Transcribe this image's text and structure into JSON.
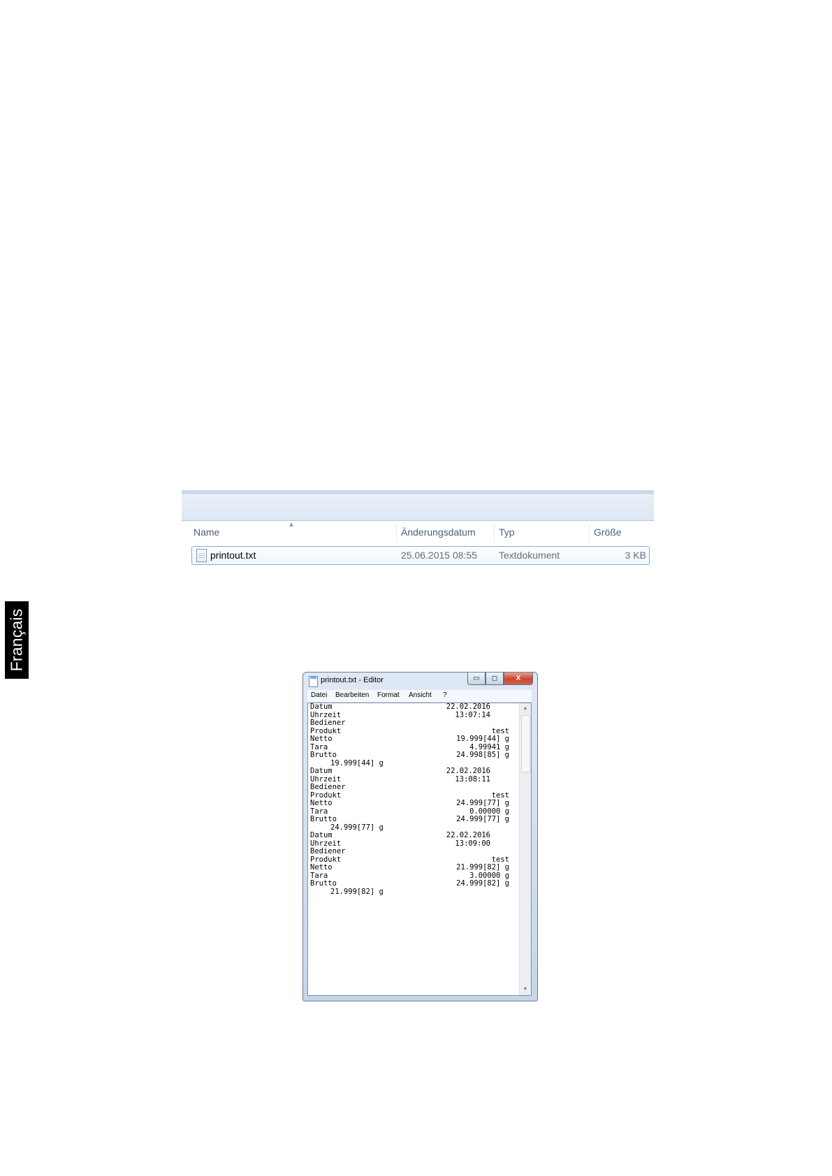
{
  "side_tab": {
    "label": "Français"
  },
  "explorer": {
    "columns": {
      "name": "Name",
      "modified": "Änderungsdatum",
      "type": "Typ",
      "size": "Größe"
    },
    "file": {
      "name": "printout.txt",
      "modified": "25.06.2015 08:55",
      "type": "Textdokument",
      "size": "3 KB"
    }
  },
  "notepad": {
    "title": "printout.txt - Editor",
    "window_buttons": {
      "minimize": "▭",
      "maximize": "◻",
      "close": "X"
    },
    "menu": {
      "file": "Datei",
      "edit": "Bearbeiten",
      "format": "Format",
      "view": "Ansicht",
      "help": "?"
    },
    "lines": [
      {
        "label": "Datum",
        "value": "22.02.2016",
        "offset": "date"
      },
      {
        "label": "Uhrzeit",
        "value": "13:07:14",
        "offset": "date"
      },
      {
        "label": "Bediener",
        "value": "",
        "offset": "date"
      },
      {
        "label": "Produkt",
        "value": "test",
        "offset": "full"
      },
      {
        "label": "Netto",
        "value": "19.999[44] g",
        "offset": "full"
      },
      {
        "label": "Tara",
        "value": "4.99941 g",
        "offset": "full"
      },
      {
        "label": "Brutto",
        "value": "24.998[85] g",
        "offset": "full"
      },
      {
        "indent": "19.999[44] g"
      },
      {
        "label": "Datum",
        "value": "22.02.2016",
        "offset": "date"
      },
      {
        "label": "Uhrzeit",
        "value": "13:08:11",
        "offset": "date"
      },
      {
        "label": "Bediener",
        "value": "",
        "offset": "date"
      },
      {
        "label": "Produkt",
        "value": "test",
        "offset": "full"
      },
      {
        "label": "Netto",
        "value": "24.999[77] g",
        "offset": "full"
      },
      {
        "label": "Tara",
        "value": "0.00000 g",
        "offset": "full"
      },
      {
        "label": "Brutto",
        "value": "24.999[77] g",
        "offset": "full"
      },
      {
        "indent": "24.999[77] g"
      },
      {
        "label": "Datum",
        "value": "22.02.2016",
        "offset": "date"
      },
      {
        "label": "Uhrzeit",
        "value": "13:09:00",
        "offset": "date"
      },
      {
        "label": "Bediener",
        "value": "",
        "offset": "date"
      },
      {
        "label": "Produkt",
        "value": "test",
        "offset": "full"
      },
      {
        "label": "Netto",
        "value": "21.999[82] g",
        "offset": "full"
      },
      {
        "label": "Tara",
        "value": "3.00000 g",
        "offset": "full"
      },
      {
        "label": "Brutto",
        "value": "24.999[82] g",
        "offset": "full"
      },
      {
        "indent": "21.999[82] g"
      }
    ]
  }
}
